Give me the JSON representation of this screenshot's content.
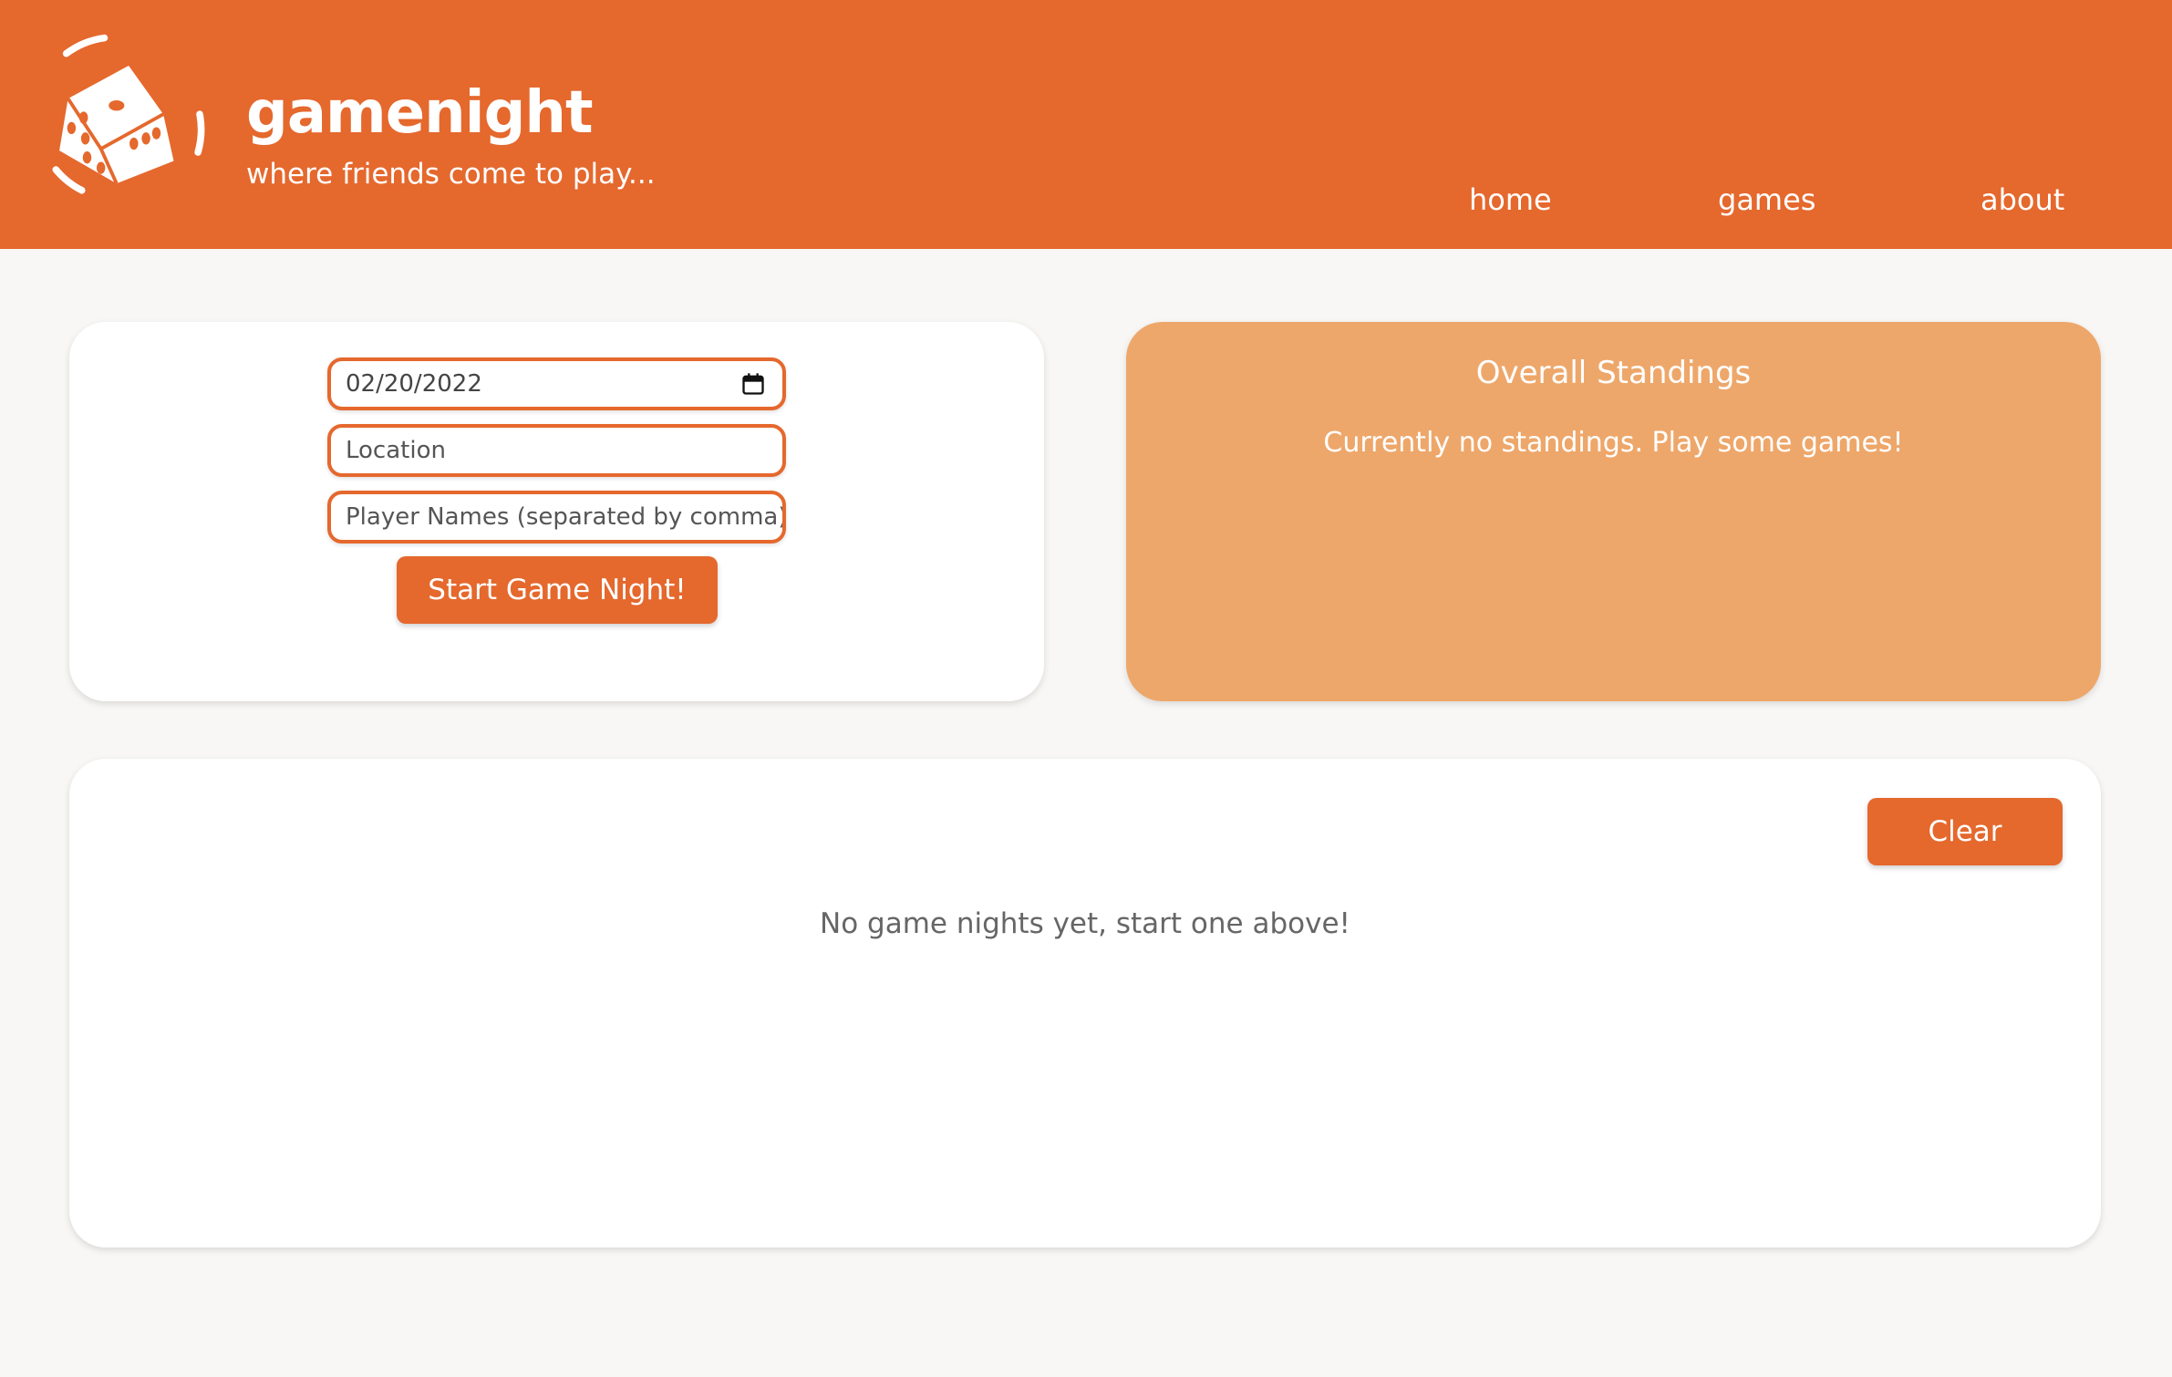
{
  "header": {
    "title": "gamenight",
    "tagline": "where friends come to play...",
    "logo_icon": "dice-icon",
    "background_color": "#e5682d"
  },
  "nav": {
    "items": [
      {
        "label": "home"
      },
      {
        "label": "games"
      },
      {
        "label": "about"
      }
    ]
  },
  "form": {
    "date_value": "02/20/2022",
    "date_icon": "calendar-icon",
    "location_placeholder": "Location",
    "players_placeholder": "Player Names (separated by comma)",
    "start_button_label": "Start Game Night!"
  },
  "standings": {
    "title": "Overall Standings",
    "empty_message": "Currently no standings. Play some games!",
    "background_color": "#eea76a"
  },
  "history": {
    "clear_button_label": "Clear",
    "empty_message": "No game nights yet, start one above!"
  },
  "colors": {
    "accent": "#e5682d",
    "page_background": "#f8f7f5",
    "card_background": "#ffffff"
  }
}
